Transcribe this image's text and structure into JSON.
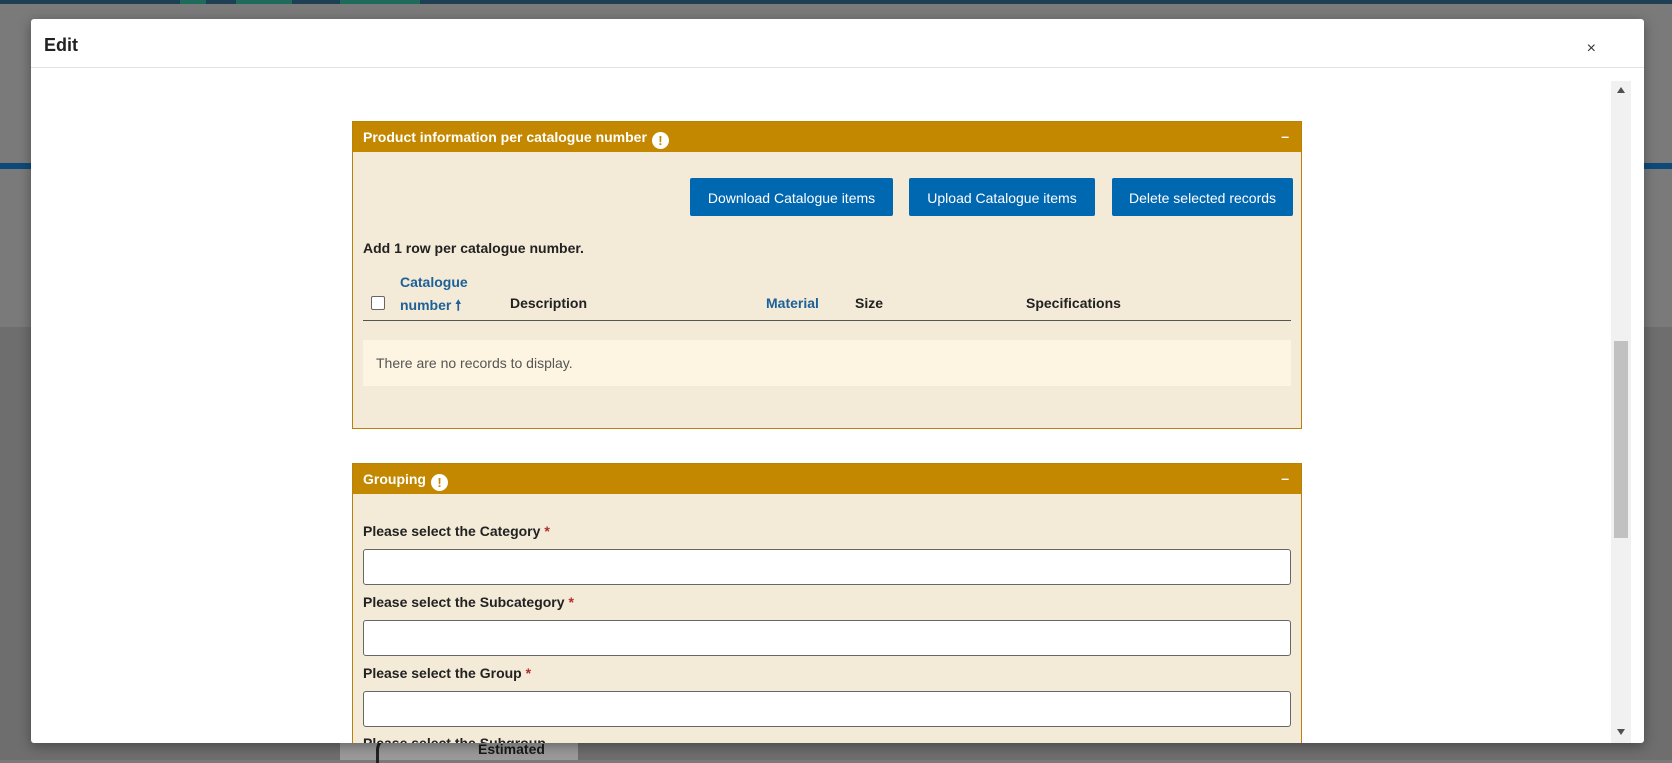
{
  "modal": {
    "title": "Edit",
    "close_label": "×"
  },
  "product_panel": {
    "title": "Product information per catalogue number",
    "info_glyph": "!",
    "collapse_glyph": "–",
    "buttons": {
      "download": "Download Catalogue items",
      "upload": "Upload Catalogue items",
      "delete": "Delete selected records"
    },
    "hint": "Add 1 row per catalogue number.",
    "columns": {
      "catalogue_line1": "Catalogue",
      "catalogue_line2": "number",
      "sort_glyph": "🠕",
      "description": "Description",
      "material": "Material",
      "size": "Size",
      "specifications": "Specifications"
    },
    "empty_message": "There are no records to display."
  },
  "grouping_panel": {
    "title": "Grouping",
    "info_glyph": "!",
    "collapse_glyph": "–",
    "required_mark": "*",
    "fields": [
      {
        "label": "Please select the Category",
        "value": ""
      },
      {
        "label": "Please select the Subcategory",
        "value": ""
      },
      {
        "label": "Please select the Group",
        "value": ""
      },
      {
        "label": "Please select the Subgroup",
        "value": ""
      }
    ]
  },
  "background": {
    "card_text": "Estimated"
  },
  "colors": {
    "panel_header": "#c48800",
    "panel_body": "#f3ead7",
    "button": "#0067b1",
    "link": "#1d6199"
  }
}
